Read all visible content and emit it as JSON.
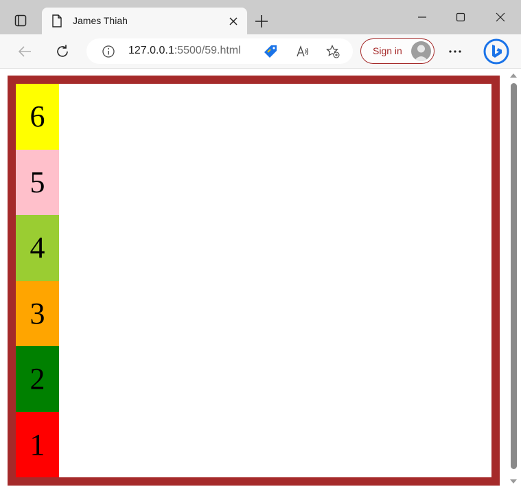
{
  "browser": {
    "tab_title": "James Thiah",
    "url_host": "127.0.0.1",
    "url_rest": ":5500/59.html",
    "signin_label": "Sign in"
  },
  "page": {
    "border_color": "#a52a2a",
    "boxes": [
      {
        "label": "6",
        "color": "#ffff00"
      },
      {
        "label": "5",
        "color": "#ffc0cb"
      },
      {
        "label": "4",
        "color": "#9acd32"
      },
      {
        "label": "3",
        "color": "#ffa500"
      },
      {
        "label": "2",
        "color": "#008000"
      },
      {
        "label": "1",
        "color": "#ff0000"
      }
    ]
  },
  "icons": {
    "tab_actions": "tab-actions-icon",
    "favicon": "file-icon",
    "close": "close-icon",
    "new_tab": "plus-icon",
    "minimize": "minimize-icon",
    "maximize": "maximize-icon",
    "window_close": "window-close-icon",
    "back": "back-arrow-icon",
    "refresh": "refresh-icon",
    "info": "info-icon",
    "tag": "tag-icon",
    "read_aloud": "read-aloud-icon",
    "favorites": "add-favorite-icon",
    "more": "more-icon",
    "bing": "bing-icon"
  }
}
